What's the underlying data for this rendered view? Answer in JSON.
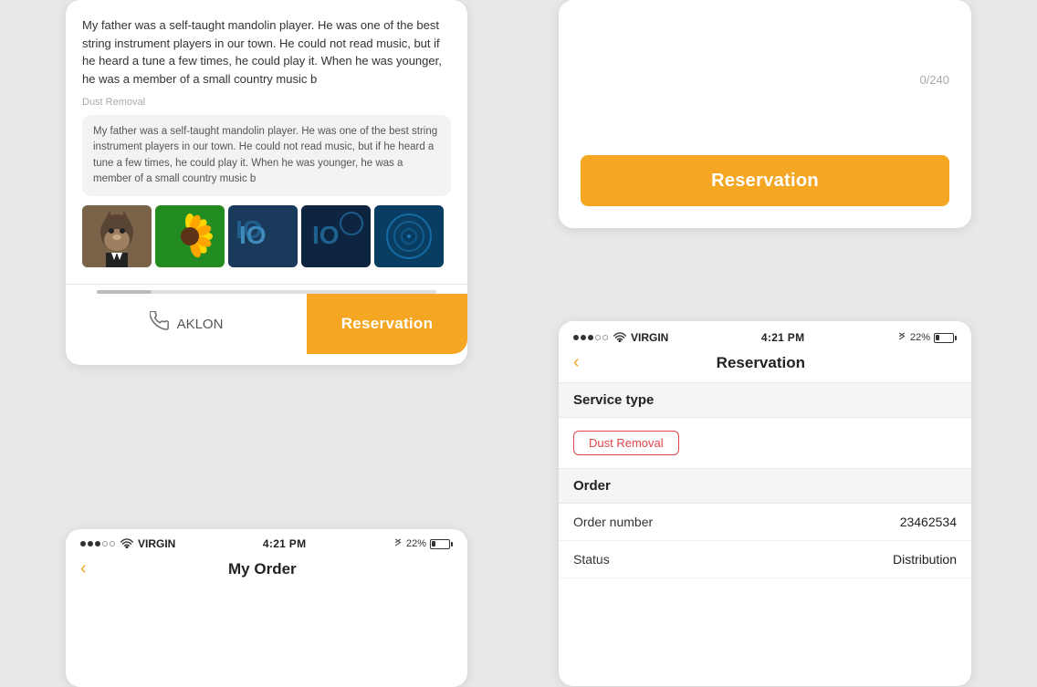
{
  "card_chat": {
    "main_text": "My father was a self-taught mandolin player. He was one of the best string instrument players in our town. He could not read music, but if he heard a tune a few times, he could play it. When he was younger, he was a member of a small country music b",
    "service_label": "Dust Removal",
    "bubble_text": "My father was a self-taught mandolin player. He was one of the best string instrument players in our town. He could not read music, but if he heard a tune a few times, he could play it. When he was younger, he was a member of a small country music b",
    "call_label": "AKLON",
    "reserve_label": "Reservation"
  },
  "card_reserve_top": {
    "count_text": "0/240",
    "reserve_label": "Reservation"
  },
  "card_myorder": {
    "status_bar": {
      "dots": [
        "filled",
        "filled",
        "filled",
        "empty",
        "empty"
      ],
      "carrier": "VIRGIN",
      "time": "4:21 PM",
      "battery_pct": "22%"
    },
    "title": "My Order",
    "back_label": "‹"
  },
  "card_reservation_detail": {
    "status_bar": {
      "dots": [
        "filled",
        "filled",
        "filled",
        "empty",
        "empty"
      ],
      "carrier": "VIRGIN",
      "time": "4:21 PM",
      "battery_pct": "22%"
    },
    "title": "Reservation",
    "back_label": "‹",
    "service_type_header": "Service type",
    "service_tag": "Dust Removal",
    "order_header": "Order",
    "rows": [
      {
        "label": "Order number",
        "value": "23462534"
      },
      {
        "label": "Status",
        "value": "Distribution"
      }
    ]
  }
}
